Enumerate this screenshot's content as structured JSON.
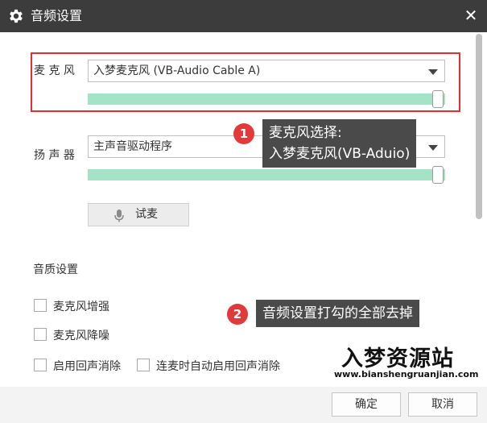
{
  "window": {
    "title": "音频设置"
  },
  "microphone": {
    "label": "麦 克 风",
    "selected": "入梦麦克风 (VB-Audio Cable A)",
    "level_fraction": 1.0
  },
  "speaker": {
    "label": "扬 声 器",
    "selected": "主声音驱动程序",
    "level_fraction": 1.0
  },
  "test_button": {
    "label": "试麦"
  },
  "quality": {
    "heading": "音质设置",
    "options": [
      {
        "label": "麦克风增强",
        "checked": false
      },
      {
        "label": "麦克风降噪",
        "checked": false
      },
      {
        "label": "启用回声消除",
        "checked": false
      },
      {
        "label": "连麦时自动启用回声消除",
        "checked": false
      }
    ]
  },
  "annotations": [
    {
      "number": "1",
      "text_line1": "麦克风选择:",
      "text_line2": "入梦麦克风(VB-Aduio)"
    },
    {
      "number": "2",
      "text_line1": "音频设置打勾的全部去掉"
    }
  ],
  "watermark": {
    "brand": "入梦资源站",
    "url": "www.bianshengruanjian.com"
  },
  "footer": {
    "ok_label": "确定",
    "cancel_label": "取消"
  },
  "colors": {
    "titlebar": "#3c3c3c",
    "level": "#a3e4c7",
    "highlight": "#e2302f",
    "badge": "#e23a3a",
    "tooltip": "#4a4a4a"
  },
  "icons": {
    "title": "gear-icon",
    "close": "close-icon",
    "test": "microphone-icon"
  }
}
